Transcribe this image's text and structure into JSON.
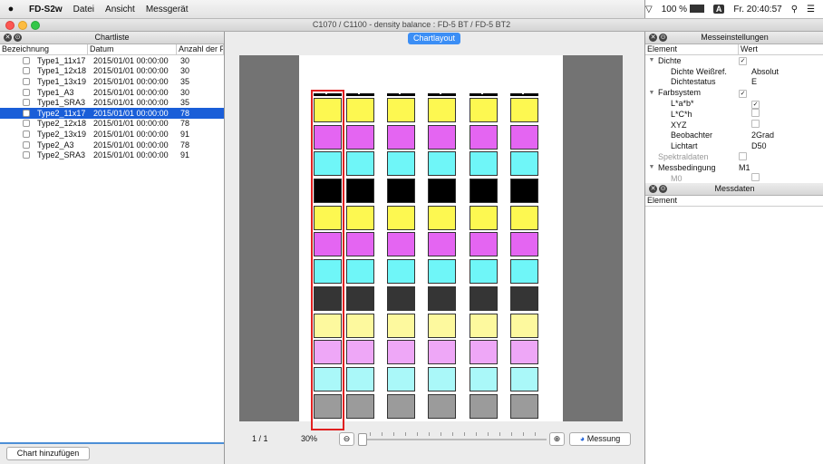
{
  "menubar": {
    "app_name": "FD-S2w",
    "menus": [
      "Datei",
      "Ansicht",
      "Messgerät"
    ],
    "battery": "100 %",
    "input_source": "A",
    "clock": "Fr. 20:40:57"
  },
  "window": {
    "title": "C1070 / C1100 - density balance : FD-5 BT / FD-5 BT2"
  },
  "chart_list": {
    "title": "Chartliste",
    "columns": [
      "Bezeichnung",
      "Datum",
      "Anzahl der Pa"
    ],
    "rows": [
      {
        "name": "Type1_11x17",
        "date": "2015/01/01 00:00:00",
        "count": "30",
        "selected": false
      },
      {
        "name": "Type1_12x18",
        "date": "2015/01/01 00:00:00",
        "count": "30",
        "selected": false
      },
      {
        "name": "Type1_13x19",
        "date": "2015/01/01 00:00:00",
        "count": "35",
        "selected": false
      },
      {
        "name": "Type1_A3",
        "date": "2015/01/01 00:00:00",
        "count": "30",
        "selected": false
      },
      {
        "name": "Type1_SRA3",
        "date": "2015/01/01 00:00:00",
        "count": "35",
        "selected": false
      },
      {
        "name": "Type2_11x17",
        "date": "2015/01/01 00:00:00",
        "count": "78",
        "selected": true
      },
      {
        "name": "Type2_12x18",
        "date": "2015/01/01 00:00:00",
        "count": "78",
        "selected": false
      },
      {
        "name": "Type2_13x19",
        "date": "2015/01/01 00:00:00",
        "count": "91",
        "selected": false
      },
      {
        "name": "Type2_A3",
        "date": "2015/01/01 00:00:00",
        "count": "78",
        "selected": false
      },
      {
        "name": "Type2_SRA3",
        "date": "2015/01/01 00:00:00",
        "count": "91",
        "selected": false
      }
    ],
    "add_button": "Chart hinzufügen"
  },
  "chart_layout": {
    "tab_label": "Chartlayout",
    "page_indicator": "1 / 1",
    "zoom": "30%",
    "measure_button": "Messung",
    "strip_count": 6,
    "patch_colors": [
      "#fdf851",
      "#e465f2",
      "#6ff6f8",
      "#000000",
      "#fdf851",
      "#e465f2",
      "#6ff6f8",
      "#353535",
      "#fdf99e",
      "#eea7f7",
      "#aaf8f9",
      "#9b9b9b"
    ]
  },
  "settings": {
    "title": "Messeinstellungen",
    "columns": [
      "Element",
      "Wert"
    ],
    "rows": [
      {
        "key": "Dichte",
        "value": "",
        "check": true,
        "level": 0,
        "expander": true
      },
      {
        "key": "Dichte Weißref.",
        "value": "Absolut",
        "check": null,
        "level": 1
      },
      {
        "key": "Dichtestatus",
        "value": "E",
        "check": null,
        "level": 1
      },
      {
        "key": "Farbsystem",
        "value": "",
        "check": true,
        "level": 0,
        "expander": true
      },
      {
        "key": "L*a*b*",
        "value": "",
        "check": true,
        "level": 1
      },
      {
        "key": "L*C*h",
        "value": "",
        "check": false,
        "level": 1
      },
      {
        "key": "XYZ",
        "value": "",
        "check": false,
        "level": 1
      },
      {
        "key": "Beobachter",
        "value": "2Grad",
        "check": null,
        "level": 1
      },
      {
        "key": "Lichtart",
        "value": "D50",
        "check": null,
        "level": 1
      },
      {
        "key": "Spektraldaten",
        "value": "",
        "check": false,
        "level": 0,
        "dim": true
      },
      {
        "key": "Messbedingung",
        "value": "M1",
        "check": null,
        "level": 0,
        "expander": true
      },
      {
        "key": "M0",
        "value": "",
        "check": false,
        "level": 1,
        "dim": true
      }
    ]
  },
  "measurement_data": {
    "title": "Messdaten",
    "column": "Element"
  }
}
